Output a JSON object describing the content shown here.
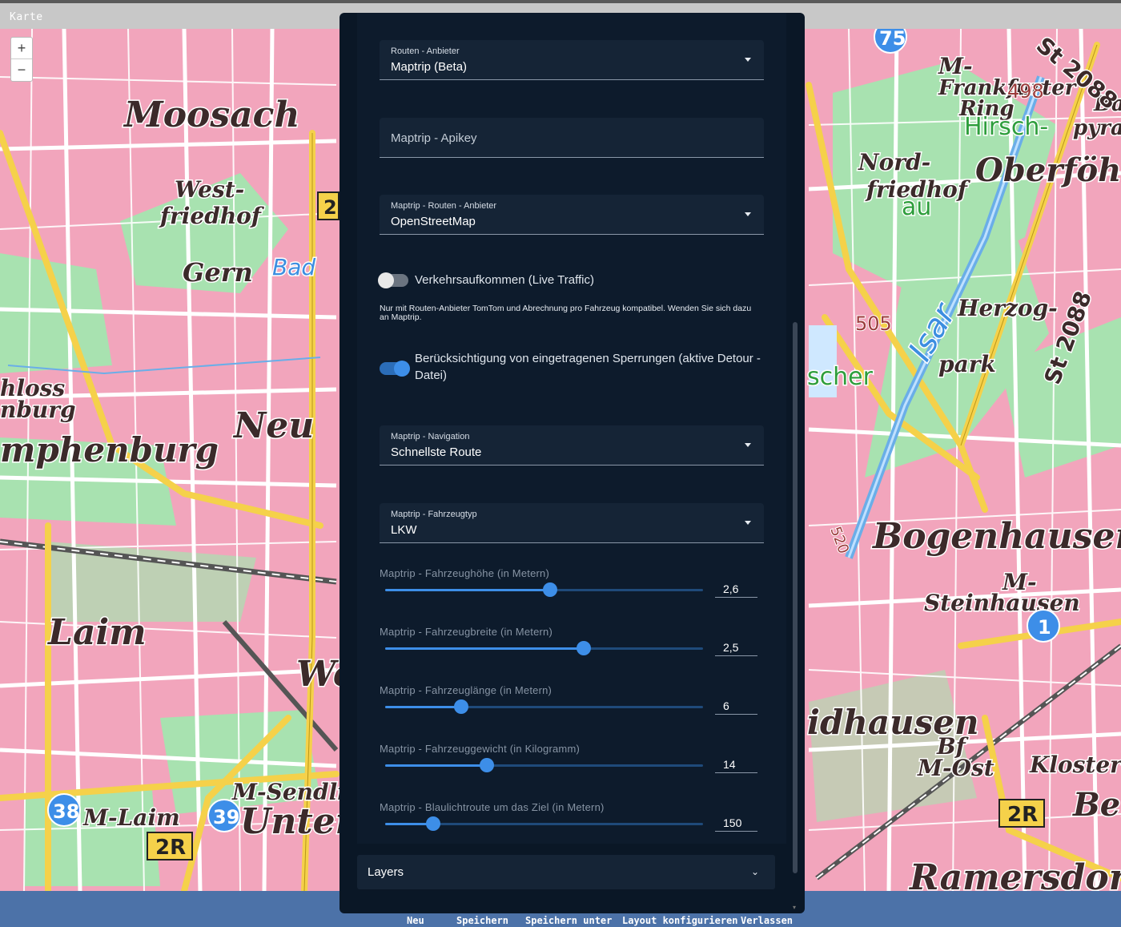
{
  "window": {
    "title": "Karte"
  },
  "map": {
    "zoom_in": "+",
    "zoom_out": "−",
    "place_labels": [
      "Moosach",
      "West-",
      "friedhof",
      "Gern",
      "Bad",
      "Neu",
      "mphenburg",
      "hloss",
      "nburg",
      "Laim",
      "M-Laim",
      "M-Sendling",
      "Unter",
      "We",
      "M-",
      "Frankfurter",
      "Ring",
      "Hirsch-",
      "Oberföhring",
      "Nord-",
      "friedhof",
      "au",
      "Herzog-",
      "park",
      "Isar",
      "scher",
      "Bogenhausen",
      "M-",
      "Steinhausen",
      "idhausen",
      "Bf",
      "M-Ost",
      "Kloster",
      "Ber",
      "Ramersdorf",
      "pyra",
      "Bar"
    ],
    "road_labels": [
      "St 2088",
      "St 2088",
      "2R",
      "2R",
      "2"
    ],
    "route_badges": [
      "75",
      "38",
      "39",
      "1"
    ],
    "elevation_labels": [
      "498",
      "505",
      "520"
    ],
    "colors": {
      "urban": "#f2a5bc",
      "green": "#a8e2b0",
      "road": "#f5d14a",
      "water": "#6aaee8"
    }
  },
  "panel": {
    "routing_provider": {
      "label": "Routen - Anbieter",
      "value": "Maptrip (Beta)"
    },
    "apikey": {
      "placeholder": "Maptrip - Apikey"
    },
    "maptrip_routing_provider": {
      "label": "Maptrip - Routen - Anbieter",
      "value": "OpenStreetMap"
    },
    "live_traffic": {
      "label": "Verkehrsaufkommen (Live Traffic)",
      "enabled": false
    },
    "hint": "Nur mit Routen-Anbieter TomTom und Abrechnung pro Fahrzeug kompatibel. Wenden Sie sich dazu an Maptrip.",
    "detour": {
      "label_line1": "Berücksichtigung von eingetragenen Sperrungen (aktive Detour -",
      "label_line2": "Datei)",
      "enabled": true
    },
    "navigation": {
      "label": "Maptrip - Navigation",
      "value": "Schnellste Route"
    },
    "vehicle_type": {
      "label": "Maptrip - Fahrzeugtyp",
      "value": "LKW"
    },
    "sliders": [
      {
        "label": "Maptrip - Fahrzeughöhe (in Metern)",
        "value": "2,6",
        "fraction": 0.52
      },
      {
        "label": "Maptrip - Fahrzeugbreite (in Metern)",
        "value": "2,5",
        "fraction": 0.625
      },
      {
        "label": "Maptrip - Fahrzeuglänge (in Metern)",
        "value": "6",
        "fraction": 0.24
      },
      {
        "label": "Maptrip - Fahrzeuggewicht (in Kilogramm)",
        "value": "14",
        "fraction": 0.32
      },
      {
        "label": "Maptrip - Blaulichtroute um das Ziel (in Metern)",
        "value": "150",
        "fraction": 0.15
      }
    ],
    "layers": {
      "label": "Layers"
    }
  },
  "bottom_bar": {
    "new": "Neu",
    "save": "Speichern",
    "save_as": "Speichern unter",
    "configure_layout": "Layout konfigurieren",
    "exit": "Verlassen"
  }
}
